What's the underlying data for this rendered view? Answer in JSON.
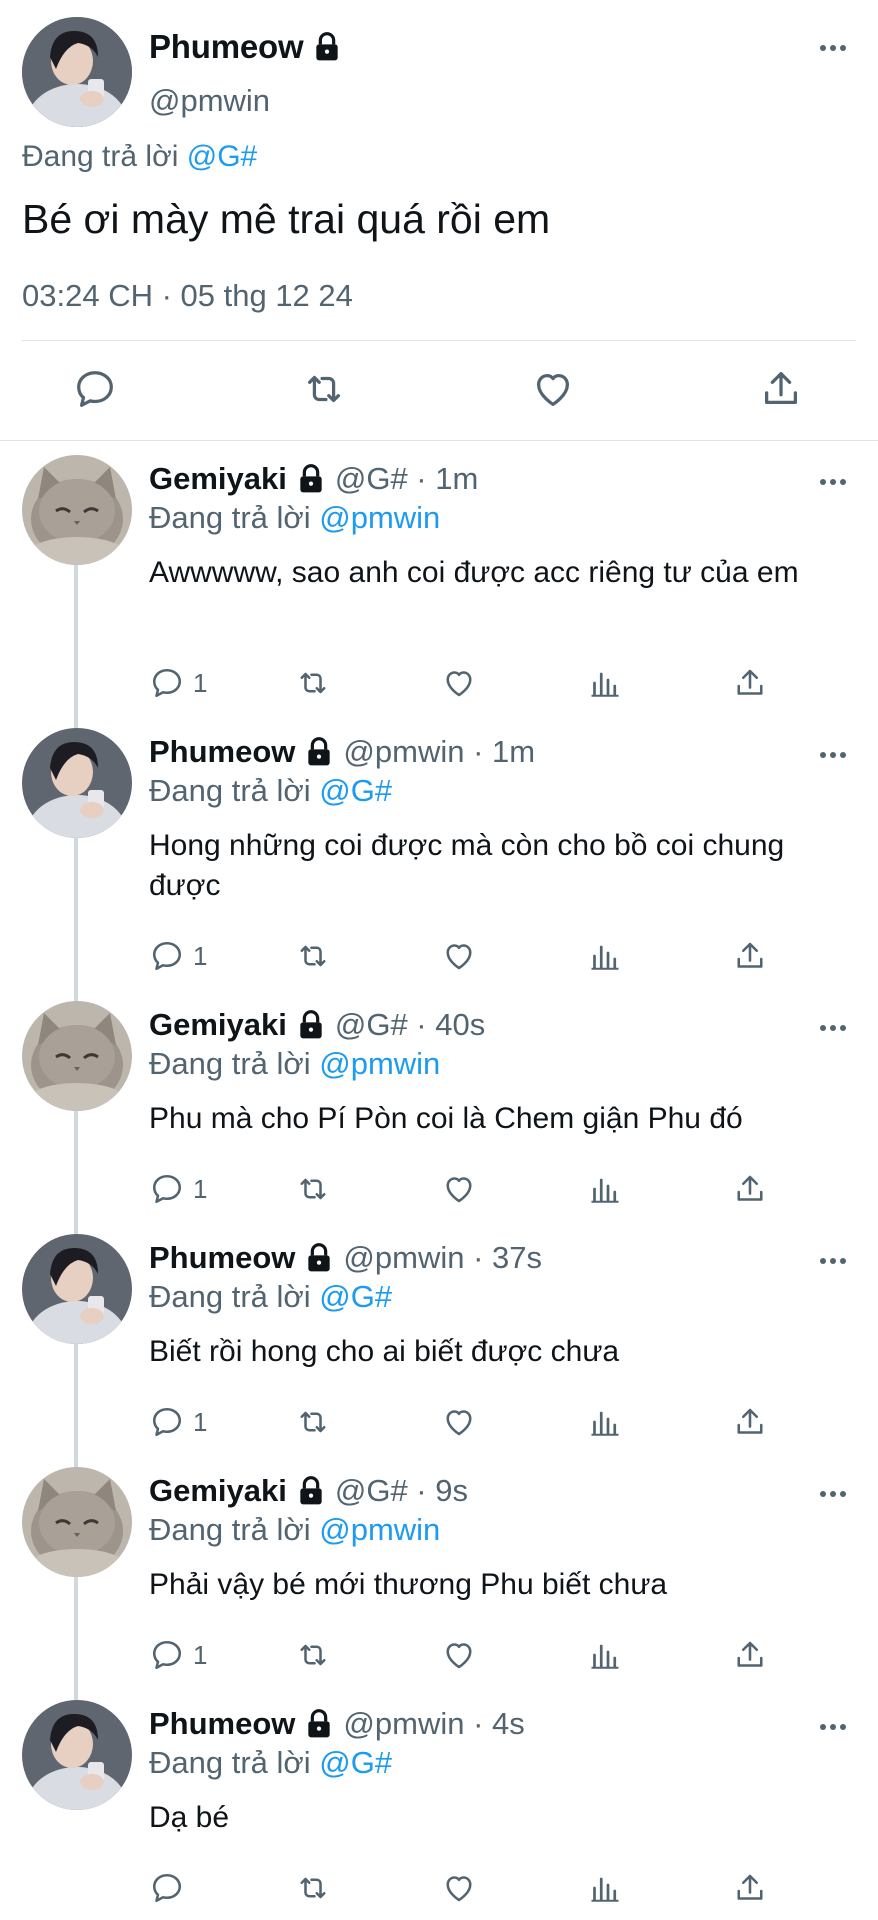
{
  "main_tweet": {
    "name": "Phumeow",
    "handle": "@pmwin",
    "replying_prefix": "Đang trả lời",
    "replying_to": "@G#",
    "text": "Bé ơi mày mê trai quá rồi em",
    "timestamp": "03:24 CH · 05 thg 12 24",
    "icons": [
      "more-icon",
      "lock-icon",
      "reply-icon",
      "retweet-icon",
      "like-icon",
      "share-icon"
    ]
  },
  "replies": [
    {
      "name": "Gemiyaki",
      "meta": "@G# · 1m",
      "replying_prefix": "Đang trả lời",
      "replying_to": "@pmwin",
      "text": "Awwwww, sao anh coi được acc riêng tư của em",
      "reply_count": "1",
      "avatar": "cat"
    },
    {
      "name": "Phumeow",
      "meta": "@pmwin · 1m",
      "replying_prefix": "Đang trả lời",
      "replying_to": "@G#",
      "text": "Hong những coi được mà còn cho bồ coi chung được",
      "reply_count": "1",
      "avatar": "person"
    },
    {
      "name": "Gemiyaki",
      "meta": "@G# · 40s",
      "replying_prefix": "Đang trả lời",
      "replying_to": "@pmwin",
      "text": "Phu mà cho Pí Pòn coi là Chem giận Phu đó",
      "reply_count": "1",
      "avatar": "cat"
    },
    {
      "name": "Phumeow",
      "meta": "@pmwin · 37s",
      "replying_prefix": "Đang trả lời",
      "replying_to": "@G#",
      "text": "Biết rồi hong cho ai biết được chưa",
      "reply_count": "1",
      "avatar": "person"
    },
    {
      "name": "Gemiyaki",
      "meta": "@G# · 9s",
      "replying_prefix": "Đang trả lời",
      "replying_to": "@pmwin",
      "text": "Phải vậy bé mới thương Phu biết chưa",
      "reply_count": "1",
      "avatar": "cat"
    },
    {
      "name": "Phumeow",
      "meta": "@pmwin · 4s",
      "replying_prefix": "Đang trả lời",
      "replying_to": "@G#",
      "text": "Dạ bé",
      "reply_count": "",
      "avatar": "person"
    }
  ],
  "colors": {
    "link": "#1d9bf0",
    "secondary_text": "#536471",
    "primary_text": "#0f1419",
    "divider": "#dfe3e7"
  }
}
